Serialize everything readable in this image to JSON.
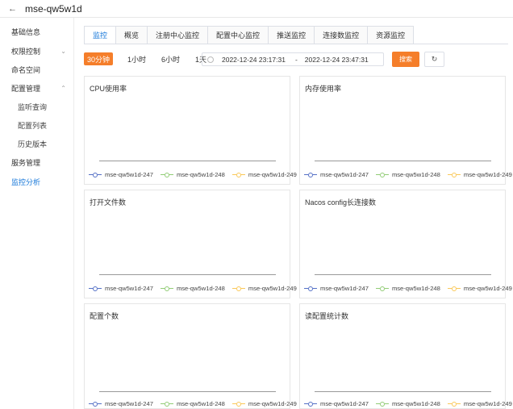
{
  "header": {
    "title": "mse-qw5w1d",
    "back_icon": "←"
  },
  "sidebar": {
    "items": [
      {
        "label": "基础信息",
        "sub": false,
        "chev": "",
        "active": false
      },
      {
        "label": "权限控制",
        "sub": false,
        "chev": "⌄",
        "active": false
      },
      {
        "label": "命名空间",
        "sub": false,
        "chev": "",
        "active": false
      },
      {
        "label": "配置管理",
        "sub": false,
        "chev": "⌃",
        "active": false
      },
      {
        "label": "监听查询",
        "sub": true,
        "chev": "",
        "active": false
      },
      {
        "label": "配置列表",
        "sub": true,
        "chev": "",
        "active": false
      },
      {
        "label": "历史版本",
        "sub": true,
        "chev": "",
        "active": false
      },
      {
        "label": "服务管理",
        "sub": false,
        "chev": "",
        "active": false
      },
      {
        "label": "监控分析",
        "sub": false,
        "chev": "",
        "active": true
      }
    ]
  },
  "tabs": [
    "监控",
    "概览",
    "注册中心监控",
    "配置中心监控",
    "推送监控",
    "连接数监控",
    "资源监控"
  ],
  "ranges": [
    "30分钟",
    "1小时",
    "6小时",
    "1天"
  ],
  "date_range": {
    "start": "2022-12-24 23:17:31",
    "separator": "-",
    "end": "2022-12-24 23:47:31"
  },
  "search_label": "搜索",
  "refresh_icon": "↻",
  "series": [
    {
      "name": "mse-qw5w1d-247",
      "color": "#5470c6"
    },
    {
      "name": "mse-qw5w1d-248",
      "color": "#91cc75"
    },
    {
      "name": "mse-qw5w1d-249",
      "color": "#fac858"
    }
  ],
  "charts": [
    {
      "title": "CPU使用率"
    },
    {
      "title": "内存使用率"
    },
    {
      "title": "打开文件数"
    },
    {
      "title": "Nacos config长连接数"
    },
    {
      "title": "配置个数"
    },
    {
      "title": "读配置统计数"
    }
  ]
}
